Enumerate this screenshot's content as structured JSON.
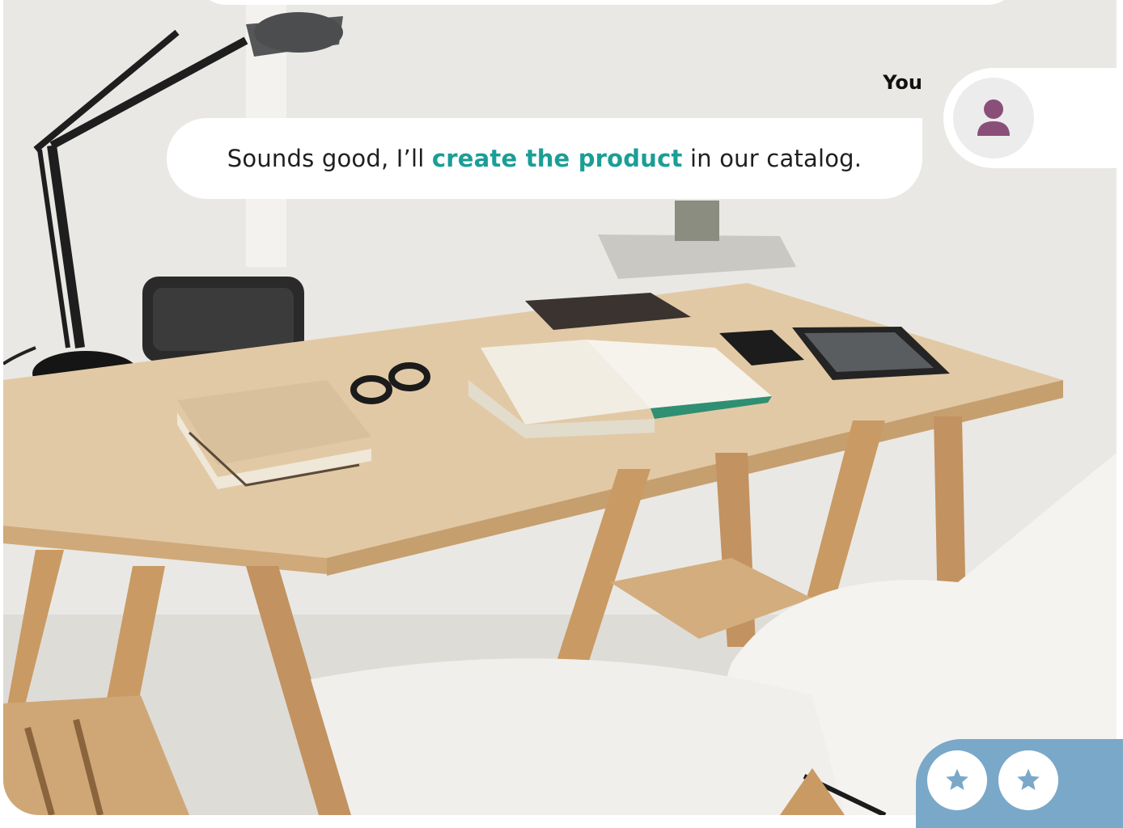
{
  "chat": {
    "sender": "You",
    "message": {
      "prefix": "Sounds good, I’ll ",
      "highlight": "create the product",
      "suffix": " in our catalog."
    }
  },
  "rating": {
    "stars": 2,
    "star_color": "#7aa8c9"
  },
  "colors": {
    "highlight": "#1a9e96",
    "avatar_icon": "#8a4f78",
    "panel": "#7aa8c9"
  },
  "icons": [
    "user-icon",
    "star-icon"
  ]
}
